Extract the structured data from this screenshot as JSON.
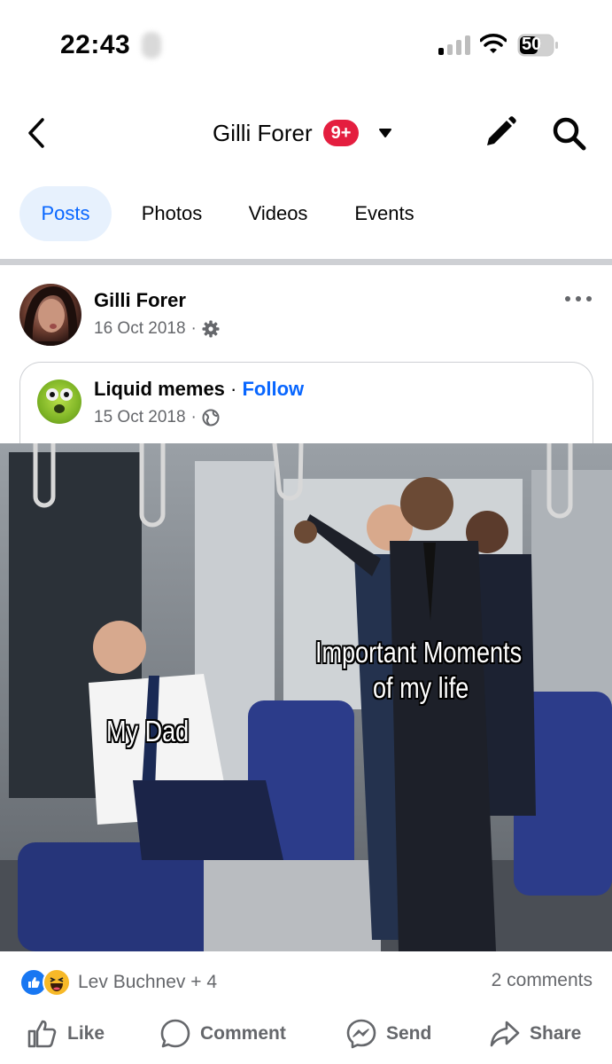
{
  "status_bar": {
    "time": "22:43",
    "battery_level": "50"
  },
  "header": {
    "title": "Gilli Forer",
    "badge": "9+"
  },
  "tabs": [
    {
      "label": "Posts",
      "active": true
    },
    {
      "label": "Photos",
      "active": false
    },
    {
      "label": "Videos",
      "active": false
    },
    {
      "label": "Events",
      "active": false
    }
  ],
  "post": {
    "author": "Gilli Forer",
    "date": "16 Oct 2018",
    "date_separator": "·",
    "shared": {
      "page_name": "Liquid memes",
      "separator": " · ",
      "follow_label": "Follow",
      "date": "15 Oct 2018",
      "date_separator": "·"
    },
    "meme_captions": {
      "left": "My Dad",
      "right_line1": "Important Moments",
      "right_line2": "of my life"
    },
    "reactions": {
      "names": "Lev Buchnev + 4",
      "comments": "2 comments"
    },
    "actions": {
      "like": "Like",
      "comment": "Comment",
      "send": "Send",
      "share": "Share"
    }
  },
  "colors": {
    "accent": "#0866ff",
    "badge": "#e41e3f",
    "muted": "#65676b",
    "active_tab_bg": "#e7f1fd"
  }
}
